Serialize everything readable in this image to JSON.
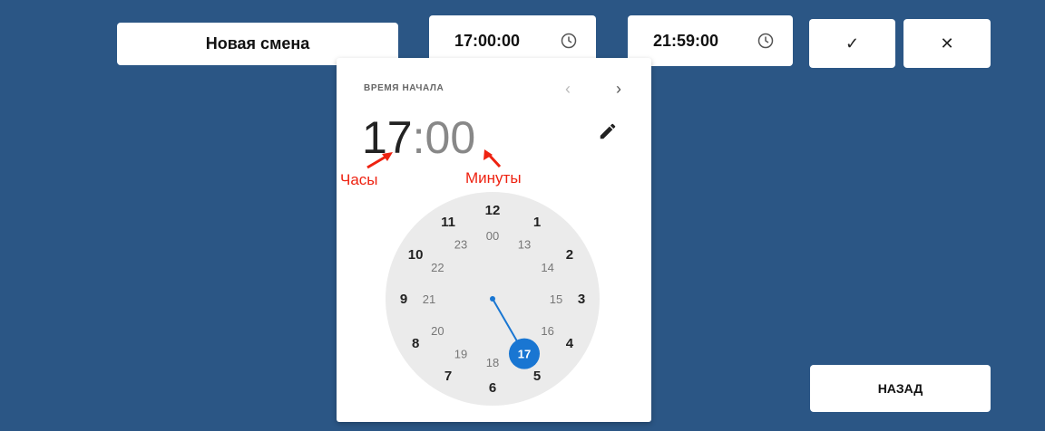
{
  "shift_name": "Новая смена",
  "start_time": "17:00:00",
  "end_time": "21:59:00",
  "confirm_icon": "✓",
  "cancel_icon": "✕",
  "back_label": "НАЗАД",
  "picker": {
    "label": "ВРЕМЯ НАЧАЛА",
    "prev_icon": "‹",
    "next_icon": "›",
    "hours": "17",
    "colon": ":",
    "minutes": "00",
    "annotation_hours": "Часы",
    "annotation_minutes": "Минуты",
    "selected_hour": 17,
    "outer_ring": [
      "12",
      "1",
      "2",
      "3",
      "4",
      "5",
      "6",
      "7",
      "8",
      "9",
      "10",
      "11"
    ],
    "inner_ring": [
      "00",
      "13",
      "14",
      "15",
      "16",
      "17",
      "18",
      "19",
      "20",
      "21",
      "22",
      "23"
    ]
  },
  "colors": {
    "background": "#2b5685",
    "accent": "#1976d2",
    "annotation": "#e21",
    "dial": "#ebebeb"
  }
}
